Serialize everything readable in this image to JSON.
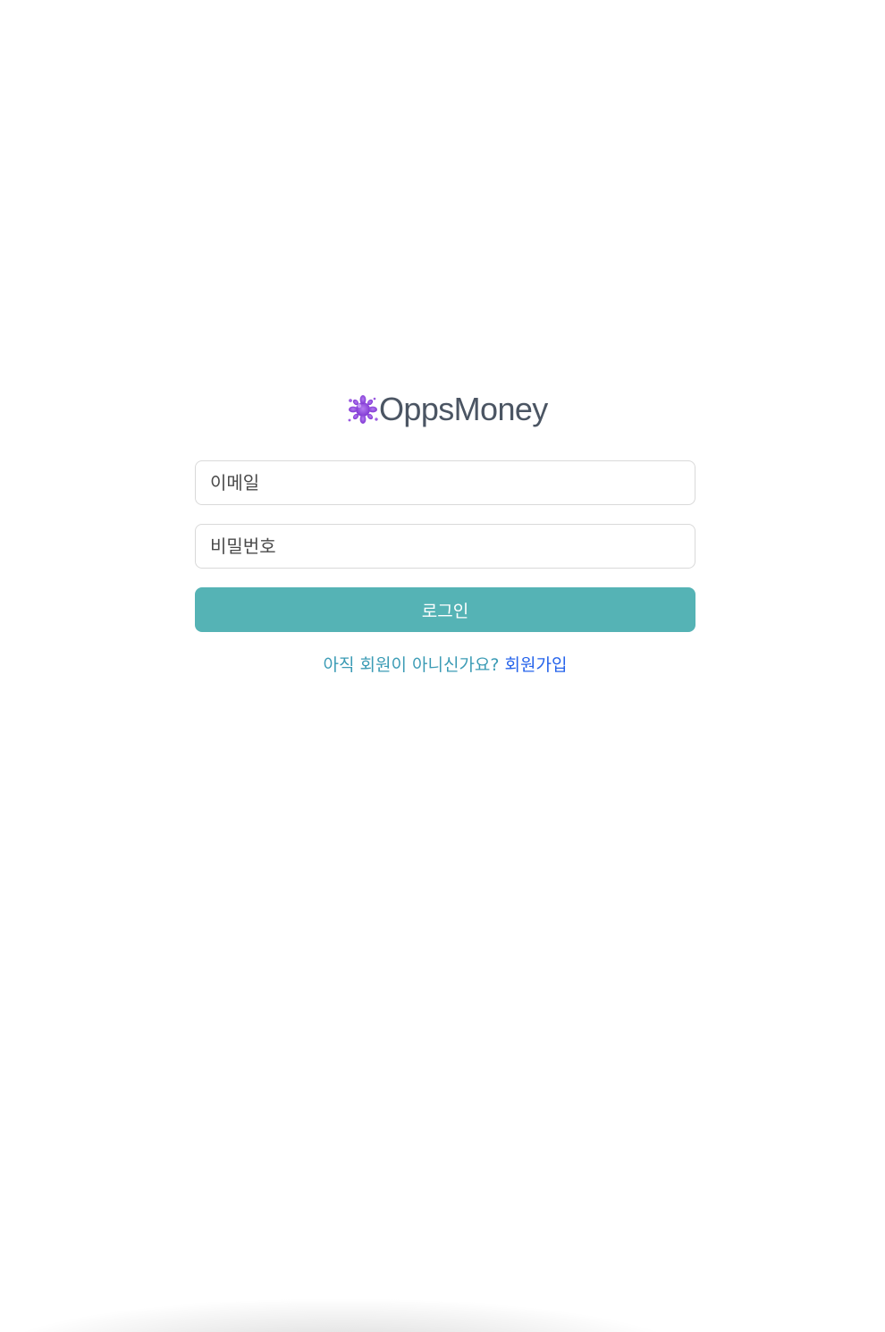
{
  "brand": {
    "name": "OppsMoney",
    "logo_icon": "purple-splash-icon",
    "logo_color": "#8b3fd9",
    "text_color": "#4b5563"
  },
  "login_form": {
    "email_placeholder": "이메일",
    "password_placeholder": "비밀번호",
    "submit_label": "로그인",
    "submit_color": "#55b3b5"
  },
  "signup": {
    "prompt": "아직 회원이 아니신가요?",
    "link_label": "회원가입",
    "prompt_color": "#3b9bb5",
    "link_color": "#2563eb"
  }
}
